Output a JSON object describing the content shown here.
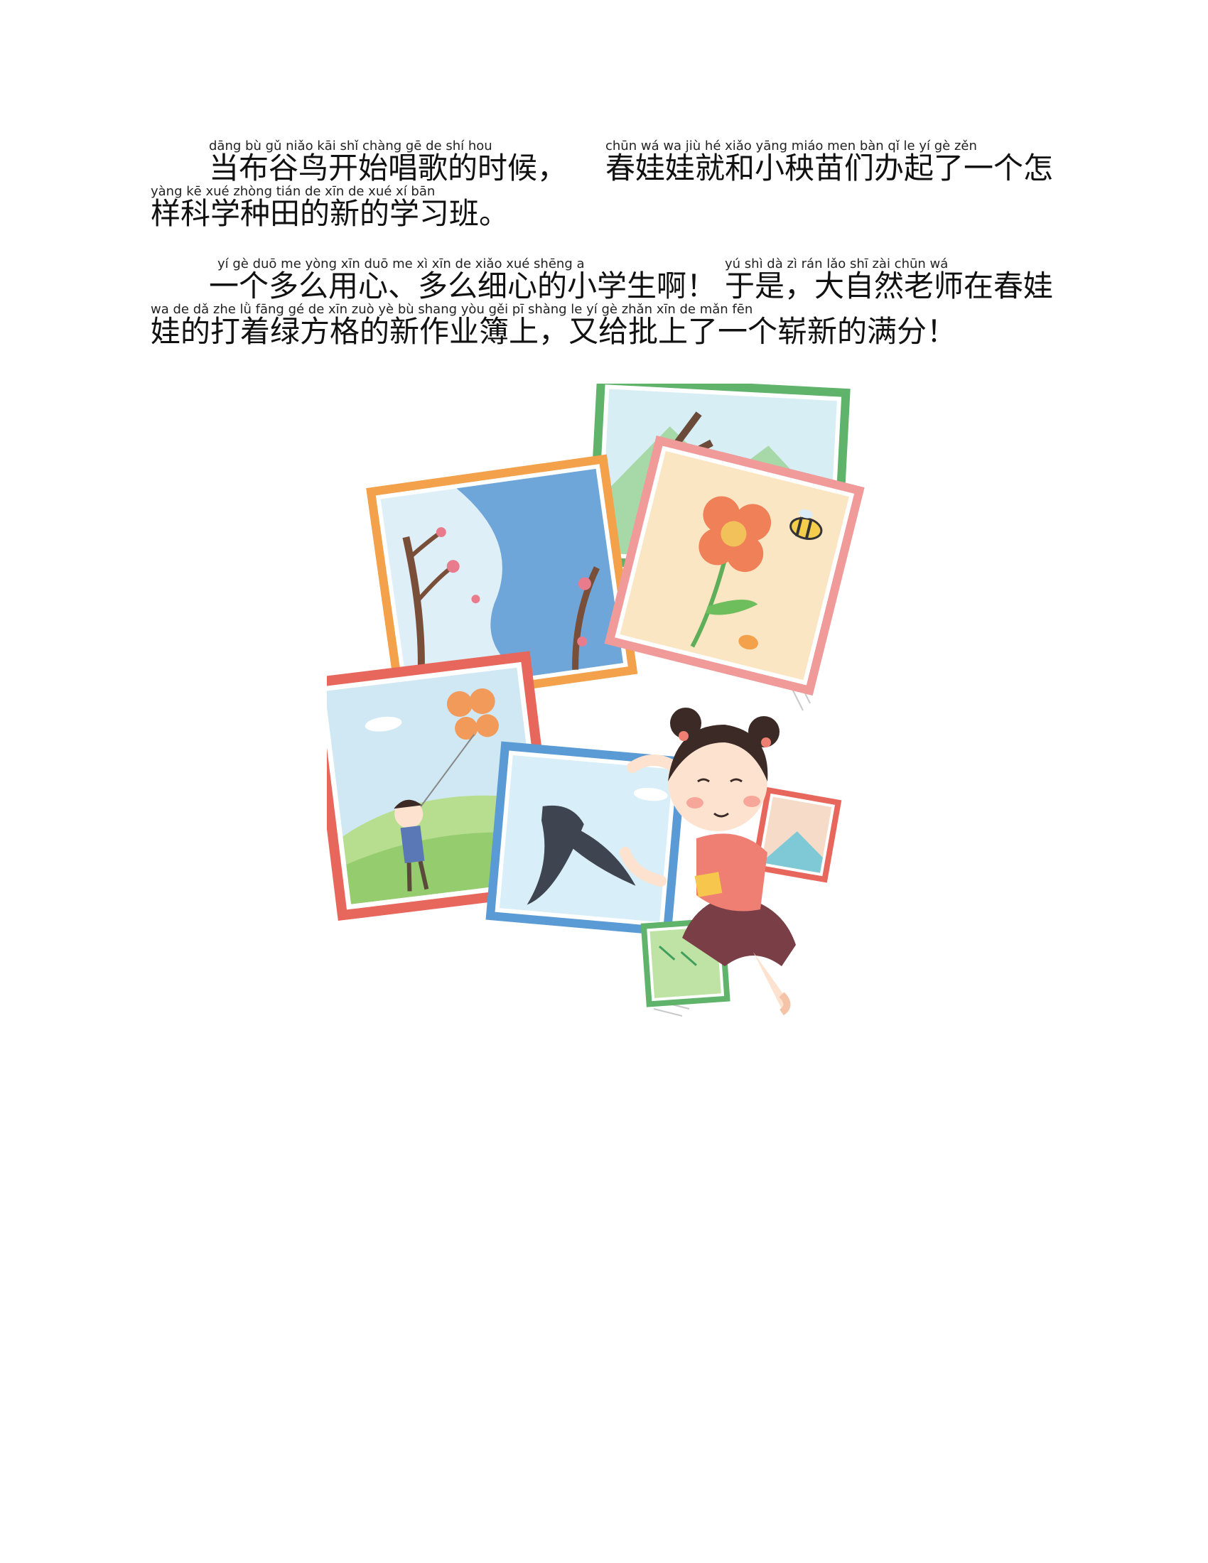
{
  "paragraph1": {
    "line1": {
      "pinyin_a": "dāng bù gǔ niǎo kāi shǐ chàng gē de shí hou",
      "text_a": "当布谷鸟开始唱歌的时候，",
      "pinyin_b": "chūn wá wa jiù hé xiǎo yāng miáo men bàn qǐ le yí gè zěn",
      "text_b": "春娃娃就和小秧苗们办起了一个怎"
    },
    "line2": {
      "pinyin": "yàng kē xué zhòng tián de xīn de xué xí bān",
      "text": "样科学种田的新的学习班。"
    }
  },
  "paragraph2": {
    "line1": {
      "pinyin_a": "yí gè duō me yòng xīn duō me xì xīn de xiǎo xué shēng a",
      "text_a": "一个多么用心、多么细心的小学生啊！",
      "pinyin_b": "yú shì dà zì rán lǎo shī zài chūn wá",
      "text_b": "于是，大自然老师在春娃"
    },
    "line2": {
      "pinyin": "wa de dǎ zhe lǜ fāng gé de xīn zuò yè bù shang yòu gěi pī shàng le yí gè zhǎn xīn de mǎn fēn",
      "text": "娃的打着绿方格的新作业簿上，又给批上了一个崭新的满分！"
    }
  },
  "illustration": {
    "name": "girl-with-paintings",
    "colors": {
      "frame_red": "#e8675c",
      "frame_orange": "#f3a14a",
      "frame_green": "#5fb36b",
      "frame_blue": "#5b9bd5",
      "sky": "#bfe0f2",
      "skin": "#fde3cf",
      "hair": "#3b2a26"
    }
  }
}
